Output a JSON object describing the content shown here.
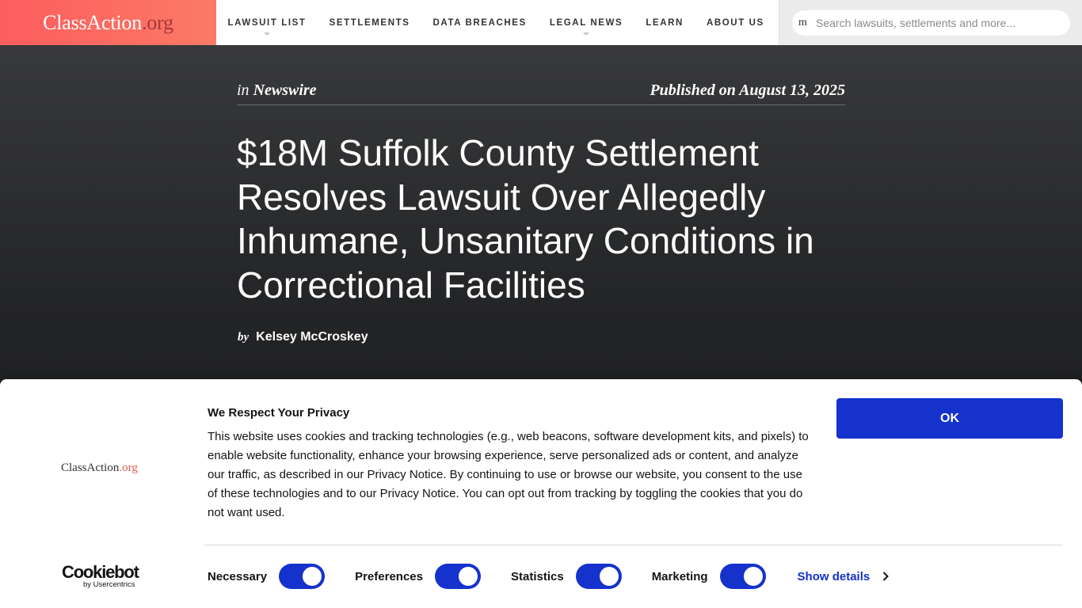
{
  "header": {
    "logo_main": "ClassAction",
    "logo_tld": ".org",
    "nav": [
      {
        "label": "LAWSUIT LIST",
        "has_dropdown": true
      },
      {
        "label": "SETTLEMENTS",
        "has_dropdown": false
      },
      {
        "label": "DATA BREACHES",
        "has_dropdown": false
      },
      {
        "label": "LEGAL NEWS",
        "has_dropdown": true
      },
      {
        "label": "LEARN",
        "has_dropdown": false
      },
      {
        "label": "ABOUT US",
        "has_dropdown": false
      }
    ],
    "search": {
      "icon": "m",
      "placeholder": "Search lawsuits, settlements and more..."
    }
  },
  "article": {
    "category_prefix": "in",
    "category": "Newswire",
    "published": "Published on August 13, 2025",
    "title": "$18M Suffolk County Settlement Resolves Lawsuit Over Allegedly Inhumane, Unsanitary Conditions in Correctional Facilities",
    "by_label": "by",
    "author": "Kelsey McCroskey"
  },
  "cookie_banner": {
    "logo_main": "ClassAction",
    "logo_tld": ".org",
    "title": "We Respect Your Privacy",
    "body": "This website uses cookies and tracking technologies (e.g., web beacons, software development kits, and pixels) to enable website functionality, enhance your browsing experience, serve personalized ads or content, and analyze our traffic, as described in our Privacy Notice. By continuing to use or browse our website, you consent to the use of these technologies and to our Privacy Notice. You can opt out from tracking by toggling the cookies that you do not want used.",
    "ok_label": "OK",
    "provider_name": "Cookiebot",
    "provider_sub": "by Usercentrics",
    "toggles": [
      {
        "label": "Necessary",
        "on": true
      },
      {
        "label": "Preferences",
        "on": true
      },
      {
        "label": "Statistics",
        "on": true
      },
      {
        "label": "Marketing",
        "on": true
      }
    ],
    "show_details_label": "Show details"
  },
  "colors": {
    "brand_coral": "#fd5d5e",
    "accent_blue": "#1532cc"
  }
}
